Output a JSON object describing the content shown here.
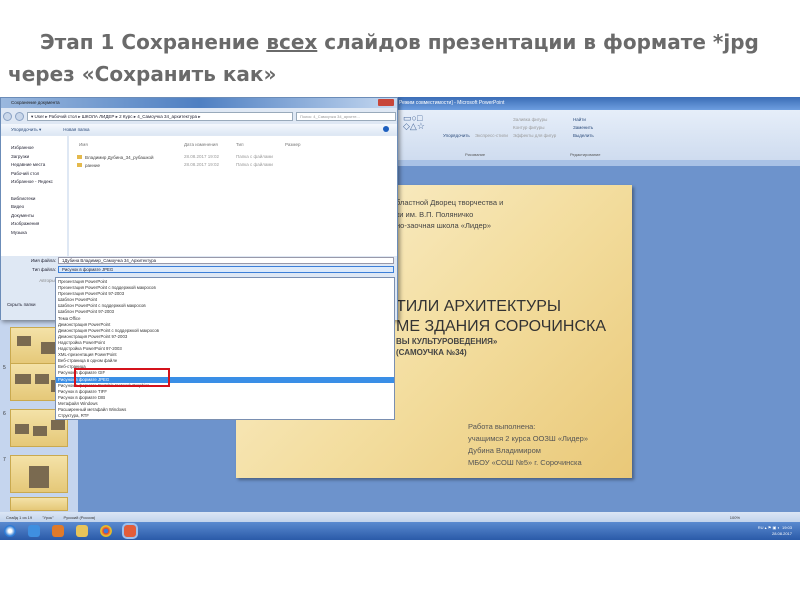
{
  "heading": {
    "pre": "Этап 1 Сохранение ",
    "underlined": "всех",
    "post": " слайдов презентации в формате  *jpg через «Сохранить как»"
  },
  "powerpoint": {
    "title": "Режим совместимости] - Microsoft PowerPoint",
    "ribbon": {
      "arrange": "Упорядочить",
      "quick_styles": "Экспресс-стили",
      "fill": "Заливка фигуры",
      "outline": "Контур фигуры",
      "effects": "Эффекты для фигур",
      "find": "Найти",
      "replace": "Заменить",
      "select": "Выделить",
      "group_drawing": "Рисование",
      "group_editing": "Редактирование"
    },
    "thumb_numbers": [
      "5",
      "6",
      "7"
    ],
    "status": {
      "slide": "Слайд 1 из 19",
      "theme": "\"Урок\"",
      "lang": "Русский (Россия)",
      "zoom": "100%"
    }
  },
  "slide": {
    "org": [
      "бластной Дворец творчества и",
      "ки им. В.П. Поляничко",
      "но-заочная школа «Лидер»"
    ],
    "title": [
      "ТИЛИ АРХИТЕКТУРЫ",
      "МЕ ЗДАНИЯ СОРОЧИНСКА"
    ],
    "subtitle": [
      "ВЫ КУЛЬТУРОВЕДЕНИЯ»",
      "(САМОУЧКА №34)"
    ],
    "work": [
      "Работа выполнена:",
      "учащимся 2 курса ООЗШ «Лидер»",
      "Дубина Владимиром",
      "МБОУ «СОШ №5» г. Сорочинска"
    ]
  },
  "dialog": {
    "title": "Сохранение документа",
    "path": "▾ User ▸ Рабочий стол ▸ ШКОЛА ЛИДЕР ▸ 2 Курс ▸ 4_Самоучка 34_архитектура ▸",
    "search_placeholder": "Поиск: 4_Самоучка 34_архите...",
    "organize": "Упорядочить ▾",
    "new_folder": "Новая папка",
    "nav": [
      "Избранное",
      "Загрузки",
      "Недавние места",
      "Рабочий стол",
      "Избранное - Яндекс",
      "Библиотеки",
      "Видео",
      "Документы",
      "Изображения",
      "Музыка"
    ],
    "columns": [
      "Имя",
      "Дата изменения",
      "Тип",
      "Размер"
    ],
    "files": [
      {
        "name": "Владимир Дубина_34_рубашкой",
        "date": "28.08.2017 19:02",
        "type": "Папка с файлами"
      },
      {
        "name": "ранние",
        "date": "28.08.2017 19:02",
        "type": "Папка с файлами"
      }
    ],
    "filename_label": "Имя файла:",
    "filename": "1Дубина Владимир_Самоучка 34_Архитектура",
    "filetype_label": "Тип файла:",
    "filetype": "Рисунок в формате JPEG",
    "authors_label": "Авторы:",
    "hide_folders": "Скрыть папки",
    "types": [
      "Презентация PowerPoint",
      "Презентация PowerPoint с поддержкой макросов",
      "Презентация PowerPoint 97-2003",
      "Шаблон PowerPoint",
      "Шаблон PowerPoint с поддержкой макросов",
      "Шаблон PowerPoint 97-2003",
      "Тема Office",
      "Демонстрация PowerPoint",
      "Демонстрация PowerPoint с поддержкой макросов",
      "Демонстрация PowerPoint 97-2003",
      "Надстройка PowerPoint",
      "Надстройка PowerPoint 97-2003",
      "XML-презентация PowerPoint",
      "Веб-страница в одном файле",
      "Веб-страница",
      "Рисунок в формате GIF",
      "Рисунок в формате JPEG",
      "Рисунок в формате Portable Network Graphics",
      "Рисунок в формате TIFF",
      "Рисунок в формате DIB",
      "Метафайл Windows",
      "Расширенный метафайл Windows",
      "Структура, RTF"
    ],
    "selected_index": 16
  },
  "tray": {
    "lang": "RU",
    "time": "19:03",
    "date": "28.08.2017"
  },
  "colors": {
    "highlight": "#3a8ee6",
    "redbox": "#d4121b",
    "workspace": "#6d93cc"
  }
}
